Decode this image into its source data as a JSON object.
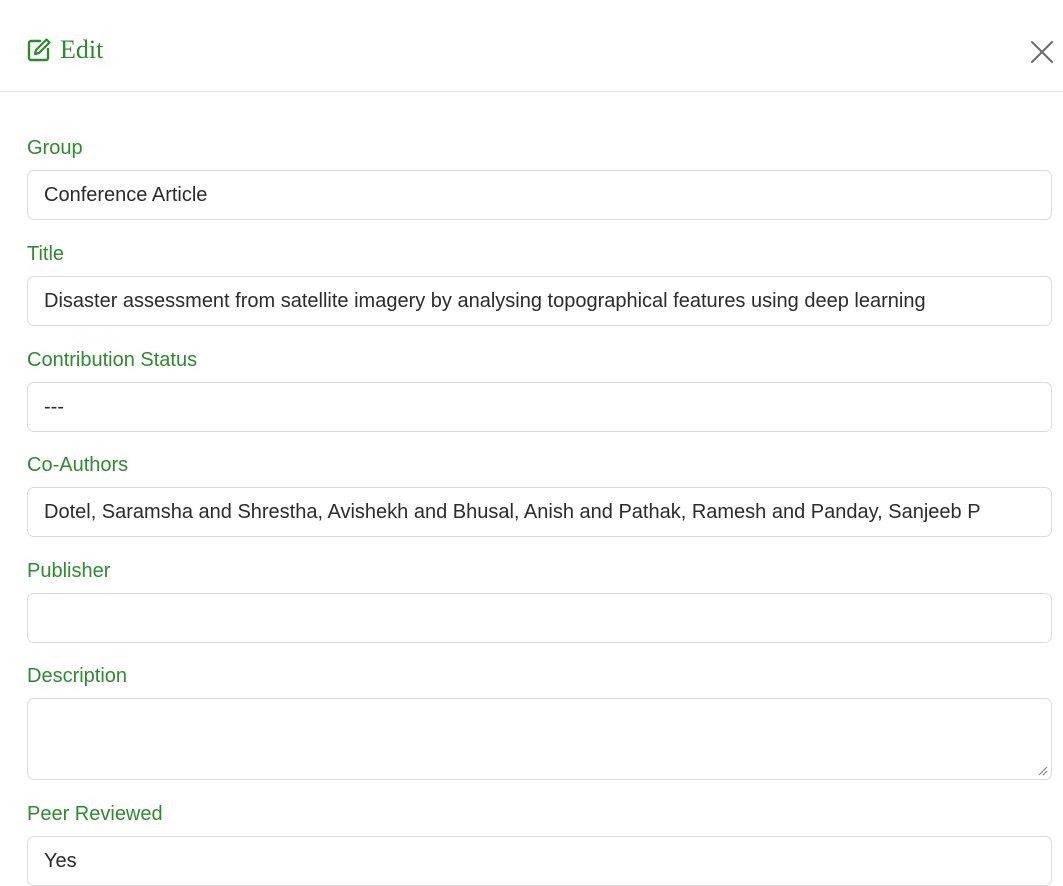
{
  "header": {
    "title": "Edit"
  },
  "form": {
    "group": {
      "label": "Group",
      "value": "Conference Article"
    },
    "title": {
      "label": "Title",
      "value": "Disaster assessment from satellite imagery by analysing topographical features using deep learning"
    },
    "contribution_status": {
      "label": "Contribution Status",
      "value": "---"
    },
    "co_authors": {
      "label": "Co-Authors",
      "value": "Dotel, Saramsha and Shrestha, Avishekh and Bhusal, Anish and Pathak, Ramesh and Panday, Sanjeeb P"
    },
    "publisher": {
      "label": "Publisher",
      "value": ""
    },
    "description": {
      "label": "Description",
      "value": ""
    },
    "peer_reviewed": {
      "label": "Peer Reviewed",
      "value": "Yes"
    }
  },
  "colors": {
    "accent": "#2e8b2e",
    "border": "#dcdcdc",
    "text": "#2b2b2b"
  },
  "icons": {
    "title_icon": "edit-icon",
    "close_icon": "close-icon"
  }
}
